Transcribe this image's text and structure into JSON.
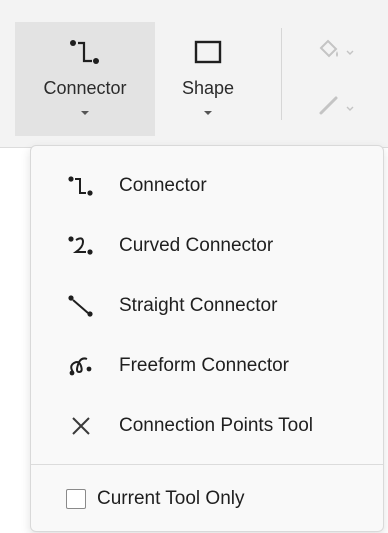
{
  "ribbon": {
    "connector_button": {
      "label": "Connector",
      "icon": "connector-icon"
    },
    "shape_button": {
      "label": "Shape",
      "icon": "rectangle-icon"
    },
    "fill_tool": {
      "icon": "fill-bucket-icon"
    },
    "line_tool": {
      "icon": "pen-line-icon"
    }
  },
  "menu": {
    "items": [
      {
        "label": "Connector",
        "icon": "connector-icon"
      },
      {
        "label": "Curved Connector",
        "icon": "curved-connector-icon"
      },
      {
        "label": "Straight Connector",
        "icon": "straight-connector-icon"
      },
      {
        "label": "Freeform Connector",
        "icon": "freeform-connector-icon"
      },
      {
        "label": "Connection Points Tool",
        "icon": "connection-points-icon"
      }
    ],
    "current_tool_only": {
      "label": "Current Tool Only",
      "checked": false
    }
  },
  "colors": {
    "accent_dark": "#1f1f1f",
    "disabled": "#bdbdbd",
    "menu_bg": "#f9f9f9"
  }
}
